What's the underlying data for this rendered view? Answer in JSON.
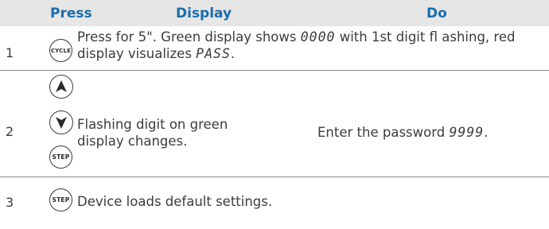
{
  "header": {
    "press": "Press",
    "display": "Display",
    "do": "Do"
  },
  "rows": [
    {
      "num": "1",
      "button_label": "CYCLE",
      "text_line1_pre": "Press for 5\". Green display shows ",
      "text_line1_seg": "0000",
      "text_line1_post": " with 1st digit fl ashing, red",
      "text_line2_pre": "display visualizes ",
      "text_line2_seg": "PASS",
      "text_line2_post": "."
    },
    {
      "num": "2",
      "buttons": [
        "up-arrow-icon",
        "down-arrow-icon",
        "STEP"
      ],
      "step_label": "STEP",
      "display_line1": "Flashing digit on green",
      "display_line2": "display changes.",
      "do_pre": "Enter the password ",
      "do_seg": "9999",
      "do_post": "."
    },
    {
      "num": "3",
      "button_label": "STEP",
      "display": "Device loads default settings."
    }
  ],
  "colors": {
    "header_bg": "#e6e6e6",
    "header_text": "#1a6dad",
    "body_text": "#3c3c3c",
    "separator": "#8a8a8a"
  }
}
